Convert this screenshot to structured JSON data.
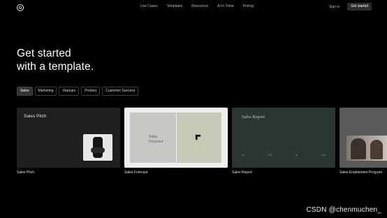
{
  "nav": {
    "links": [
      "Use Cases",
      "Templates",
      "Resources",
      "AI in Tome",
      "Pricing"
    ],
    "sign_in": "Sign in",
    "get_started": "Get started"
  },
  "hero": {
    "line1": "Get started",
    "line2": "with a template."
  },
  "filters": [
    {
      "label": "Sales",
      "active": true
    },
    {
      "label": "Marketing",
      "active": false
    },
    {
      "label": "Startups",
      "active": false
    },
    {
      "label": "Product",
      "active": false
    },
    {
      "label": "Customer Success",
      "active": false
    }
  ],
  "cards": [
    {
      "title": "Sales Pitch",
      "inner_title": "Sales Pitch"
    },
    {
      "title": "Sales Forecast",
      "inner_title_line1": "Sales",
      "inner_title_line2": "Forecast"
    },
    {
      "title": "Sales Report",
      "inner_title": "Sales Report",
      "stats": [
        "1k",
        "7/10",
        "4k",
        "2.1k"
      ]
    },
    {
      "title": "Sales Enablement Program"
    }
  ],
  "watermark": "CSDN @chenmuchen_",
  "colors": {
    "background": "#000000",
    "accent_button": "#2d2d2d",
    "card_dark": "#1f1f1f",
    "card_light": "#eeeeee",
    "card_green": "#2b3632"
  },
  "icons": {
    "logo": "tome-ring-logo"
  }
}
